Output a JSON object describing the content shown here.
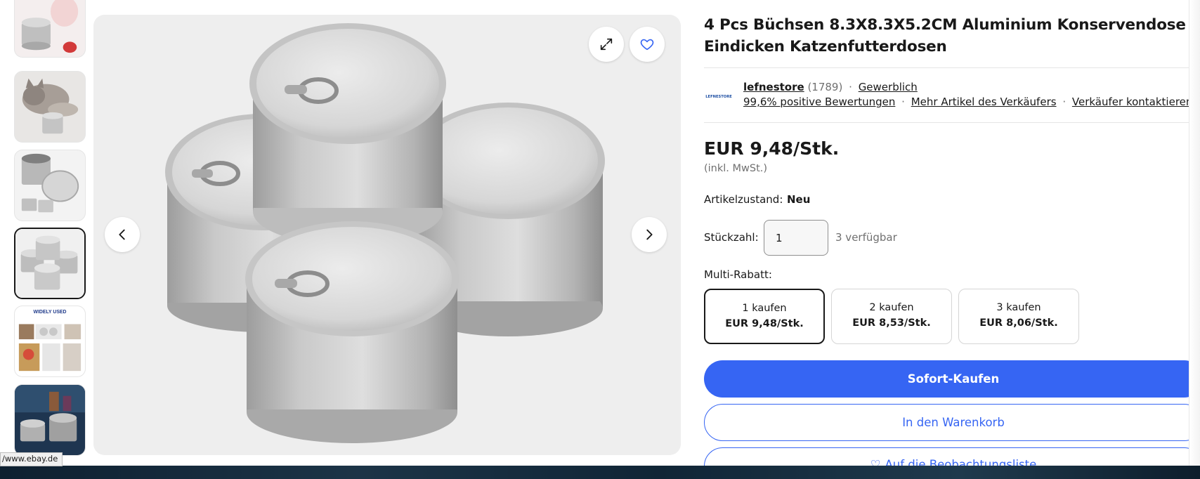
{
  "product": {
    "title": "4 Pcs Büchsen 8.3X8.3X5.2CM Aluminium Konservendose Eindicken Katzenfutterdosen",
    "main_image_alt": "aluminium-cans-stack",
    "thumbnails": [
      {
        "id": "thumb-1",
        "alt": "cans-with-strawberries"
      },
      {
        "id": "thumb-2",
        "alt": "kitten-with-can"
      },
      {
        "id": "thumb-3",
        "alt": "open-can-with-lid"
      },
      {
        "id": "thumb-4",
        "alt": "four-cans-stack"
      },
      {
        "id": "thumb-5",
        "alt": "widely-used-collage"
      },
      {
        "id": "thumb-6",
        "alt": "cans-blue-background"
      }
    ],
    "thumb5_banner": "WIDELY USED",
    "active_thumbnail": 4
  },
  "seller": {
    "logo_text": "LEFNESTORE",
    "name": "lefnestore",
    "rating_count": "(1789)",
    "type": "Gewerblich",
    "positive": "99,6% positive Bewertungen",
    "more_items": "Mehr Artikel des Verkäufers",
    "contact": "Verkäufer kontaktieren"
  },
  "pricing": {
    "price": "EUR 9,48/Stk.",
    "vat_note": "(inkl. MwSt.)"
  },
  "condition": {
    "label": "Artikelzustand:",
    "value": "Neu"
  },
  "quantity": {
    "label": "Stückzahl:",
    "value": "1",
    "available": "3 verfügbar"
  },
  "multi_discount": {
    "label": "Multi-Rabatt:",
    "tiers": [
      {
        "qty": "1 kaufen",
        "price": "EUR 9,48/Stk."
      },
      {
        "qty": "2 kaufen",
        "price": "EUR 8,53/Stk."
      },
      {
        "qty": "3 kaufen",
        "price": "EUR 8,06/Stk."
      }
    ],
    "selected_index": 0
  },
  "actions": {
    "buy_now": "Sofort-Kaufen",
    "add_to_cart": "In den Warenkorb",
    "watchlist": "Auf die Beobachtungsliste"
  },
  "status_bar": {
    "url": "/www.ebay.de"
  },
  "icons": {
    "expand": "expand-icon",
    "favorite": "heart-icon",
    "prev": "chevron-left-icon",
    "next": "chevron-right-icon"
  },
  "colors": {
    "accent": "#3665f3",
    "text": "#191919",
    "muted": "#707070",
    "border": "#e5e5e5"
  }
}
